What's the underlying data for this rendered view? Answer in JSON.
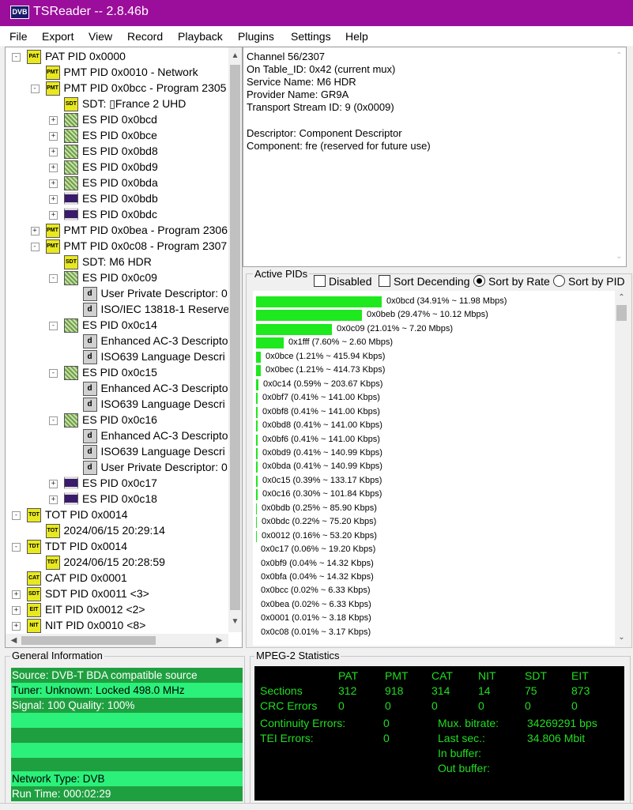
{
  "titlebar": {
    "icon": "DVB",
    "title": "TSReader -- 2.8.46b"
  },
  "menu": [
    "File",
    "Export",
    "View",
    "Record",
    "Playback",
    "Plugins",
    "Settings",
    "Help"
  ],
  "tree": [
    {
      "label": "PAT PID 0x0000",
      "icon": "PAT",
      "exp": "-",
      "depth": 0
    },
    {
      "label": "PMT PID 0x0010 - Network",
      "icon": "PMT",
      "exp": "",
      "depth": 1
    },
    {
      "label": "PMT PID 0x0bcc - Program 2305",
      "icon": "PMT",
      "exp": "-",
      "depth": 1
    },
    {
      "label": "SDT: ▯France 2 UHD",
      "icon": "SDT",
      "exp": "",
      "depth": 2
    },
    {
      "label": "ES PID 0x0bcd",
      "icon": "grid",
      "exp": "+",
      "depth": 2
    },
    {
      "label": "ES PID 0x0bce",
      "icon": "grid",
      "exp": "+",
      "depth": 2
    },
    {
      "label": "ES PID 0x0bd8",
      "icon": "grid",
      "exp": "+",
      "depth": 2
    },
    {
      "label": "ES PID 0x0bd9",
      "icon": "grid",
      "exp": "+",
      "depth": 2
    },
    {
      "label": "ES PID 0x0bda",
      "icon": "grid",
      "exp": "+",
      "depth": 2
    },
    {
      "label": "ES PID 0x0bdb",
      "icon": "video",
      "exp": "+",
      "depth": 2
    },
    {
      "label": "ES PID 0x0bdc",
      "icon": "video",
      "exp": "+",
      "depth": 2
    },
    {
      "label": "PMT PID 0x0bea - Program 2306",
      "icon": "PMT",
      "exp": "+",
      "depth": 1
    },
    {
      "label": "PMT PID 0x0c08 - Program 2307",
      "icon": "PMT",
      "exp": "-",
      "depth": 1
    },
    {
      "label": "SDT: M6 HDR",
      "icon": "SDT",
      "exp": "",
      "depth": 2
    },
    {
      "label": "ES PID 0x0c09",
      "icon": "grid",
      "exp": "-",
      "depth": 2
    },
    {
      "label": "User Private Descriptor: 0",
      "icon": "desc",
      "exp": "",
      "depth": 3
    },
    {
      "label": "ISO/IEC 13818-1 Reserve",
      "icon": "desc",
      "exp": "",
      "depth": 3
    },
    {
      "label": "ES PID 0x0c14",
      "icon": "grid",
      "exp": "-",
      "depth": 2
    },
    {
      "label": "Enhanced AC-3 Descripto",
      "icon": "desc",
      "exp": "",
      "depth": 3
    },
    {
      "label": "ISO639 Language Descri",
      "icon": "desc",
      "exp": "",
      "depth": 3
    },
    {
      "label": "ES PID 0x0c15",
      "icon": "grid",
      "exp": "-",
      "depth": 2
    },
    {
      "label": "Enhanced AC-3 Descripto",
      "icon": "desc",
      "exp": "",
      "depth": 3
    },
    {
      "label": "ISO639 Language Descri",
      "icon": "desc",
      "exp": "",
      "depth": 3
    },
    {
      "label": "ES PID 0x0c16",
      "icon": "grid",
      "exp": "-",
      "depth": 2
    },
    {
      "label": "Enhanced AC-3 Descripto",
      "icon": "desc",
      "exp": "",
      "depth": 3
    },
    {
      "label": "ISO639 Language Descri",
      "icon": "desc",
      "exp": "",
      "depth": 3
    },
    {
      "label": "User Private Descriptor: 0",
      "icon": "desc",
      "exp": "",
      "depth": 3
    },
    {
      "label": "ES PID 0x0c17",
      "icon": "video",
      "exp": "+",
      "depth": 2
    },
    {
      "label": "ES PID 0x0c18",
      "icon": "video",
      "exp": "+",
      "depth": 2
    },
    {
      "label": "TOT PID 0x0014",
      "icon": "TOT",
      "exp": "-",
      "depth": 0
    },
    {
      "label": "2024/06/15 20:29:14",
      "icon": "TOT",
      "exp": "",
      "depth": 1
    },
    {
      "label": "TDT PID 0x0014",
      "icon": "TDT",
      "exp": "-",
      "depth": 0
    },
    {
      "label": "2024/06/15 20:28:59",
      "icon": "TDT",
      "exp": "",
      "depth": 1
    },
    {
      "label": "CAT PID 0x0001",
      "icon": "CAT",
      "exp": "",
      "depth": 0
    },
    {
      "label": "SDT PID 0x0011 <3>",
      "icon": "SDT",
      "exp": "+",
      "depth": 0
    },
    {
      "label": "EIT PID 0x0012 <2>",
      "icon": "EIT",
      "exp": "+",
      "depth": 0
    },
    {
      "label": "NIT PID 0x0010 <8>",
      "icon": "NIT",
      "exp": "+",
      "depth": 0
    }
  ],
  "info": [
    "Channel 56/2307",
    "On Table_ID: 0x42 (current mux)",
    "Service Name: M6 HDR",
    "Provider Name: GR9A",
    "Transport Stream ID: 9 (0x0009)",
    "",
    "Descriptor: Component Descriptor",
    "Component:  fre (reserved for future use)"
  ],
  "active_pids": {
    "title": "Active PIDs",
    "options": {
      "disabled": "Disabled",
      "sort_desc": "Sort Decending",
      "sort_rate": "Sort by Rate",
      "sort_pid": "Sort by PID"
    },
    "selected": "sort_rate",
    "rows": [
      {
        "pct": 34.91,
        "label": "0x0bcd (34.91% ~ 11.98 Mbps)"
      },
      {
        "pct": 29.47,
        "label": "0x0beb (29.47% ~ 10.12 Mbps)"
      },
      {
        "pct": 21.01,
        "label": "0x0c09 (21.01% ~ 7.20 Mbps)"
      },
      {
        "pct": 7.6,
        "label": "0x1fff (7.60% ~ 2.60 Mbps)"
      },
      {
        "pct": 1.21,
        "label": "0x0bce (1.21% ~ 415.94 Kbps)"
      },
      {
        "pct": 1.21,
        "label": "0x0bec (1.21% ~ 414.73 Kbps)"
      },
      {
        "pct": 0.59,
        "label": "0x0c14 (0.59% ~ 203.67 Kbps)"
      },
      {
        "pct": 0.41,
        "label": "0x0bf7 (0.41% ~ 141.00 Kbps)"
      },
      {
        "pct": 0.41,
        "label": "0x0bf8 (0.41% ~ 141.00 Kbps)"
      },
      {
        "pct": 0.41,
        "label": "0x0bd8 (0.41% ~ 141.00 Kbps)"
      },
      {
        "pct": 0.41,
        "label": "0x0bf6 (0.41% ~ 141.00 Kbps)"
      },
      {
        "pct": 0.41,
        "label": "0x0bd9 (0.41% ~ 140.99 Kbps)"
      },
      {
        "pct": 0.41,
        "label": "0x0bda (0.41% ~ 140.99 Kbps)"
      },
      {
        "pct": 0.39,
        "label": "0x0c15 (0.39% ~ 133.17 Kbps)"
      },
      {
        "pct": 0.3,
        "label": "0x0c16 (0.30% ~ 101.84 Kbps)"
      },
      {
        "pct": 0.25,
        "label": "0x0bdb (0.25% ~ 85.90 Kbps)"
      },
      {
        "pct": 0.22,
        "label": "0x0bdc (0.22% ~ 75.20 Kbps)"
      },
      {
        "pct": 0.16,
        "label": "0x0012 (0.16% ~ 53.20 Kbps)"
      },
      {
        "pct": 0.06,
        "label": "0x0c17 (0.06% ~ 19.20 Kbps)"
      },
      {
        "pct": 0.04,
        "label": "0x0bf9 (0.04% ~ 14.32 Kbps)"
      },
      {
        "pct": 0.04,
        "label": "0x0bfa (0.04% ~ 14.32 Kbps)"
      },
      {
        "pct": 0.02,
        "label": "0x0bcc (0.02% ~ 6.33 Kbps)"
      },
      {
        "pct": 0.02,
        "label": "0x0bea (0.02% ~ 6.33 Kbps)"
      },
      {
        "pct": 0.01,
        "label": "0x0001 (0.01% ~ 3.18 Kbps)"
      },
      {
        "pct": 0.01,
        "label": "0x0c08 (0.01% ~ 3.17 Kbps)"
      }
    ]
  },
  "general": {
    "title": "General Information",
    "rows": [
      "Source: DVB-T BDA compatible source",
      "Tuner: Unknown: Locked 498.0 MHz",
      "Signal: 100 Quality: 100%",
      "",
      "",
      "",
      "",
      "Network Type: DVB",
      "Run Time: 000:02:29"
    ]
  },
  "mpeg": {
    "title": "MPEG-2 Statistics",
    "columns": [
      "PAT",
      "PMT",
      "CAT",
      "NIT",
      "SDT",
      "EIT"
    ],
    "sections_label": "Sections",
    "sections": [
      "312",
      "918",
      "314",
      "14",
      "75",
      "873"
    ],
    "crc_label": "CRC Errors",
    "crc": [
      "0",
      "0",
      "0",
      "0",
      "0",
      "0"
    ],
    "continuity_label": "Continuity Errors:",
    "continuity": "0",
    "tei_label": "TEI Errors:",
    "tei": "0",
    "mux_label": "Mux. bitrate:",
    "mux": "34269291 bps",
    "last_label": "Last sec.:",
    "last": "34.806 Mbit",
    "in_label": "In buffer:",
    "out_label": "Out buffer:"
  },
  "colors": {
    "titlebar": "#9b0d9b",
    "bar": "#1ee81e",
    "stat_text": "#22dd22"
  }
}
